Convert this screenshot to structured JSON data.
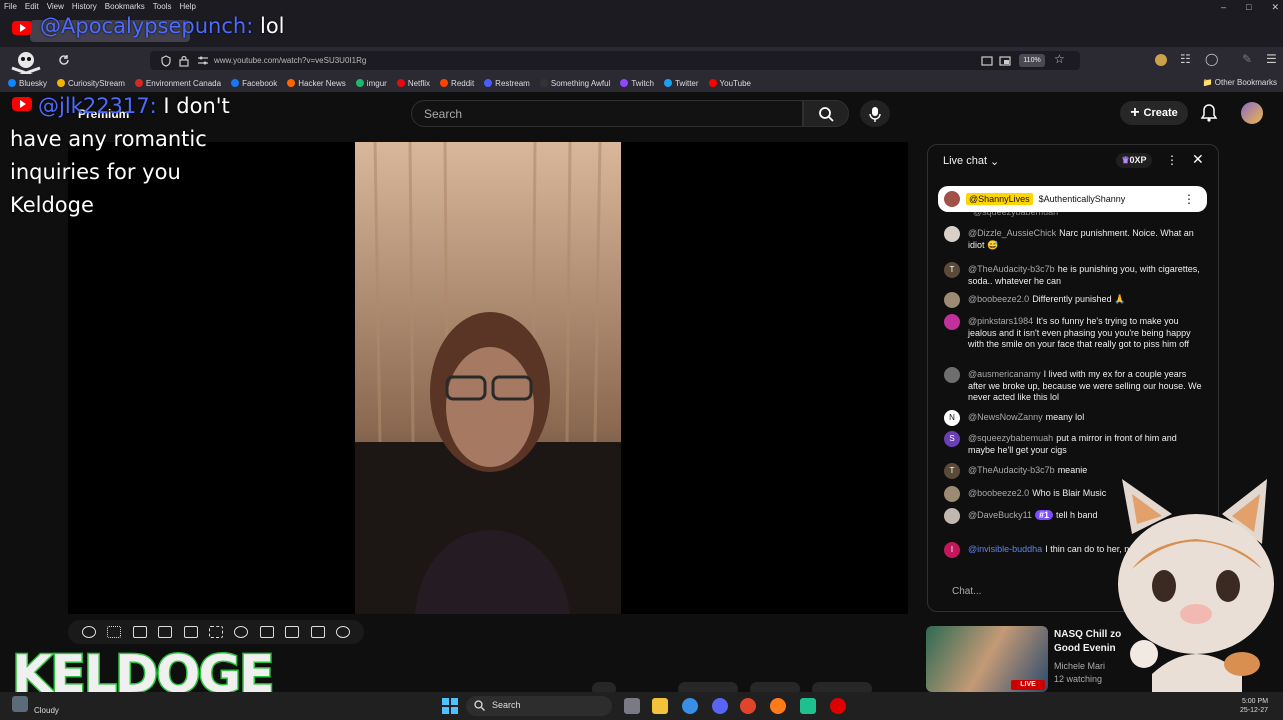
{
  "browser": {
    "menu": [
      "File",
      "Edit",
      "View",
      "History",
      "Bookmarks",
      "Tools",
      "Help"
    ],
    "url": "www.youtube.com/watch?v=veSU3U0I1Rg",
    "zoom": "110%",
    "bookmarks": [
      {
        "label": "Bluesky",
        "color": "#1185fe"
      },
      {
        "label": "CuriosityStream",
        "color": "#f4b400"
      },
      {
        "label": "Environment Canada",
        "color": "#d52b1e"
      },
      {
        "label": "Facebook",
        "color": "#1877f2"
      },
      {
        "label": "Hacker News",
        "color": "#ff6600"
      },
      {
        "label": "imgur",
        "color": "#1bb76e"
      },
      {
        "label": "Netflix",
        "color": "#e50914"
      },
      {
        "label": "Reddit",
        "color": "#ff4500"
      },
      {
        "label": "Restream",
        "color": "#4a5cff"
      },
      {
        "label": "Something Awful",
        "color": "#333333"
      },
      {
        "label": "Twitch",
        "color": "#9146ff"
      },
      {
        "label": "Twitter",
        "color": "#1da1f2"
      },
      {
        "label": "YouTube",
        "color": "#ff0000"
      }
    ],
    "other_bookmarks": "Other Bookmarks"
  },
  "youtube": {
    "brand": "Premium",
    "search_placeholder": "Search",
    "create_label": "Create"
  },
  "overlays": {
    "msg1_user": "@Apocalypsepunch",
    "msg1_text": "lol",
    "msg2_user": "@jlk22317",
    "msg2_text": "I don't have any romantic inquiries for you Keldoge",
    "logo_text": "KELDOGE"
  },
  "chat": {
    "title": "Live chat",
    "xp": "0XP",
    "pinned_user": "@ShannyLives",
    "pinned_text": "$AuthenticallyShanny",
    "partial_top": "@squeezybabemuah",
    "messages": [
      {
        "user": "@Dizzle_AussieChick",
        "text": "Narc punishment. Noice. What an idiot 😅",
        "av": "",
        "avcolor": "#d8d0c8"
      },
      {
        "user": "@TheAudacity-b3c7b",
        "text": "he is punishing you, with cigarettes, soda.. whatever he can",
        "av": "T",
        "avcolor": "#5a4a3a"
      },
      {
        "user": "@boobeeze2.0",
        "text": "Differently punished 🙏",
        "av": "",
        "avcolor": "#9c8a72"
      },
      {
        "user": "@pinkstars1984",
        "text": "It's so funny he's trying to make you jealous and it isn't even phasing you you're being happy with the smile on your face that really got to piss him off",
        "av": "",
        "avcolor": "#c2309c"
      },
      {
        "user": "@ausmericanamy",
        "text": "I lived with my ex for a couple years after we broke up, because we were selling our house. We never acted like this lol",
        "av": "",
        "avcolor": "#6e6e6e"
      },
      {
        "user": "@NewsNowZanny",
        "text": "meany lol",
        "av": "N",
        "avcolor": "#ffffff"
      },
      {
        "user": "@squeezybabemuah",
        "text": "put a mirror in front of him and maybe he'll get your cigs",
        "av": "S",
        "avcolor": "#6a3fb5"
      },
      {
        "user": "@TheAudacity-b3c7b",
        "text": "meanie",
        "av": "T",
        "avcolor": "#5a4a3a"
      },
      {
        "user": "@boobeeze2.0",
        "text": "Who is Blair Music",
        "av": "",
        "avcolor": "#9c8a72"
      },
      {
        "user": "@DaveBucky11",
        "text": "tell h band",
        "av": "",
        "avcolor": "#c0b8b0",
        "badge": "#1"
      },
      {
        "user": "@invisible-buddha",
        "text": "I thin can do to her, not get her cig",
        "av": "I",
        "avcolor": "#c2185b"
      }
    ],
    "input_placeholder": "Chat..."
  },
  "recommendation": {
    "title_line1": "NASQ Chill zo",
    "title_line2": "Good Evenin",
    "channel": "Michele Mari",
    "watching": "12 watching",
    "live": "LIVE"
  },
  "taskbar": {
    "weather": "Cloudy",
    "search": "Search",
    "time": "5:00 PM",
    "date": "25-12-27"
  }
}
